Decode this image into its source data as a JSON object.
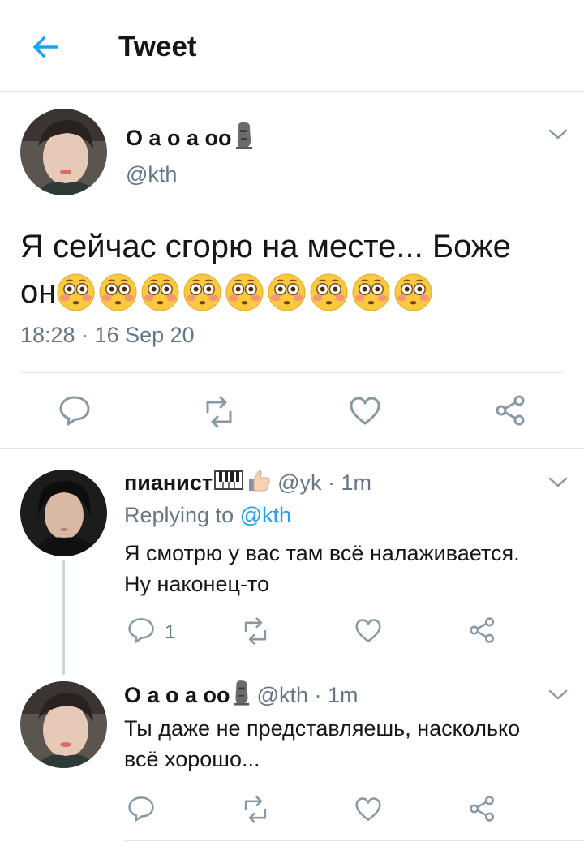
{
  "header": {
    "title": "Tweet"
  },
  "main_tweet": {
    "display_name": "О а о а оо",
    "handle": "@kth",
    "text_line1": "Я сейчас сгорю на месте... Боже",
    "text_line2_prefix": "он",
    "timestamp": "18:28 · 16 Sep 20"
  },
  "reply1": {
    "display_name": "пианист",
    "handle_time": "@yk · 1m",
    "replying_prefix": "Replying to",
    "replying_handle": "@kth",
    "text_line1": "Я смотрю у вас там всё налаживается.",
    "text_line2": "Ну наконец-то",
    "reply_count": "1"
  },
  "reply2": {
    "display_name": "О а о а оо",
    "handle_time": "@kth · 1m",
    "text_line1": "Ты даже не представляешь, насколько",
    "text_line2": "всё хорошо..."
  },
  "colors": {
    "accent": "#1da1f2",
    "muted": "#657786",
    "icon": "#8899a6",
    "divider": "#e1e8ed"
  }
}
